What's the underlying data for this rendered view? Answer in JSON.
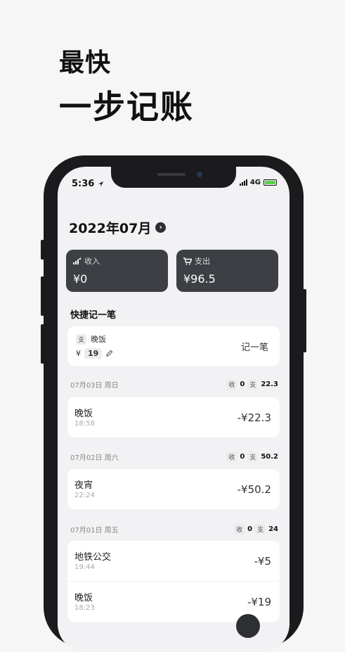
{
  "promo": {
    "line1": "最快",
    "line2": "一步记账"
  },
  "status_bar": {
    "time": "5:36",
    "network": "4G"
  },
  "header": {
    "month": "2022年07月",
    "chevron_icon": "chevron-right-icon"
  },
  "summary": {
    "income": {
      "label": "收入",
      "amount": "¥0"
    },
    "expense": {
      "label": "支出",
      "amount": "¥96.5"
    }
  },
  "quick_entry": {
    "section_title": "快捷记一笔",
    "type_tag": "支",
    "name": "晚饭",
    "currency": "¥",
    "amount": "19",
    "action_label": "记一笔"
  },
  "days": [
    {
      "date": "07月03日 周日",
      "income_tag": "收",
      "income": "0",
      "expense_tag": "支",
      "expense": "22.3",
      "items": [
        {
          "name": "晚饭",
          "time": "18:58",
          "amount": "-¥22.3"
        }
      ]
    },
    {
      "date": "07月02日 周六",
      "income_tag": "收",
      "income": "0",
      "expense_tag": "支",
      "expense": "50.2",
      "items": [
        {
          "name": "夜宵",
          "time": "22:24",
          "amount": "-¥50.2"
        }
      ]
    },
    {
      "date": "07月01日 周五",
      "income_tag": "收",
      "income": "0",
      "expense_tag": "支",
      "expense": "24",
      "items": [
        {
          "name": "地铁公交",
          "time": "19:44",
          "amount": "-¥5"
        },
        {
          "name": "晚饭",
          "time": "18:23",
          "amount": "-¥19"
        }
      ]
    }
  ],
  "colors": {
    "card_bg": "#3c3f44",
    "screen_bg": "#f2f2f4",
    "phone_frame": "#1b1b1d",
    "battery_green": "#5ad14b"
  }
}
